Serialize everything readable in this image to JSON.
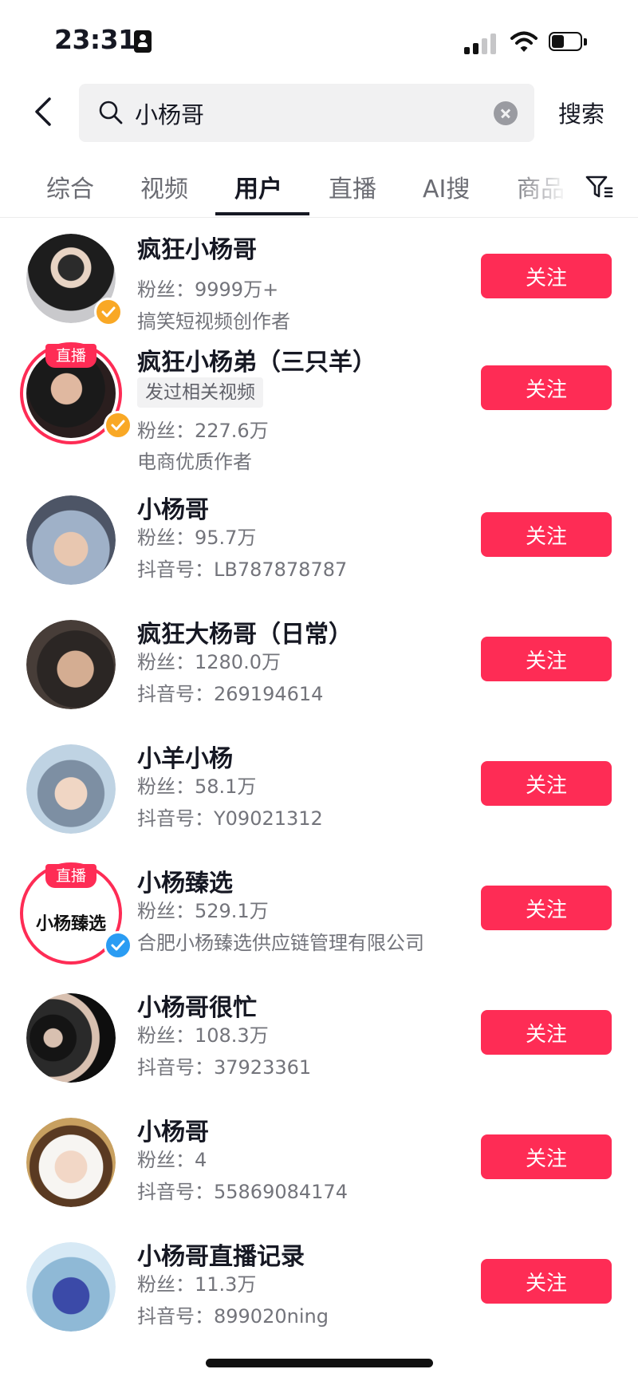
{
  "status_bar": {
    "time": "23:31",
    "battery_level": 0.45
  },
  "search": {
    "query": "小杨哥",
    "button_label": "搜索"
  },
  "tabs": [
    {
      "label": "综合"
    },
    {
      "label": "视频"
    },
    {
      "label": "用户"
    },
    {
      "label": "直播"
    },
    {
      "label": "AI搜"
    },
    {
      "label": "商品"
    }
  ],
  "active_tab": "用户",
  "follow_label": "关注",
  "live_label": "直播",
  "users": [
    {
      "name": "疯狂小杨哥",
      "fans": "粉丝：9999万+",
      "detail": "搞笑短视频创作者",
      "verified": "gold",
      "live": false
    },
    {
      "name": "疯狂小杨弟（三只羊）",
      "tag": "发过相关视频",
      "fans": "粉丝：227.6万",
      "detail": "电商优质作者",
      "verified": "gold",
      "live": true
    },
    {
      "name": "小杨哥",
      "fans": "粉丝：95.7万",
      "detail": "抖音号：LB787878787",
      "live": false
    },
    {
      "name": "疯狂大杨哥（日常）",
      "fans": "粉丝：1280.0万",
      "detail": "抖音号：269194614",
      "live": false
    },
    {
      "name": "小羊小杨",
      "fans": "粉丝：58.1万",
      "detail": "抖音号：Y09021312",
      "live": false
    },
    {
      "name": "小杨臻选",
      "fans": "粉丝：529.1万",
      "detail": "合肥小杨臻选供应链管理有限公司",
      "verified": "blue",
      "live": true,
      "logo_text": "小杨臻选"
    },
    {
      "name": "小杨哥很忙",
      "fans": "粉丝：108.3万",
      "detail": "抖音号：37923361",
      "live": false
    },
    {
      "name": "小杨哥",
      "fans": "粉丝：4",
      "detail": "抖音号：55869084174",
      "live": false
    },
    {
      "name": "小杨哥直播记录",
      "fans": "粉丝：11.3万",
      "detail": "抖音号：899020ning",
      "live": false
    }
  ],
  "colors": {
    "accent": "#fe2c55",
    "gold_badge": "#f9a825",
    "blue_badge": "#2a9cf3",
    "text": "#161823",
    "muted": "#73747b"
  },
  "icons": [
    "back-arrow-icon",
    "search-icon",
    "clear-icon",
    "filter-icon",
    "verified-icon",
    "signal-icon",
    "wifi-icon",
    "battery-icon",
    "id-card-icon"
  ]
}
